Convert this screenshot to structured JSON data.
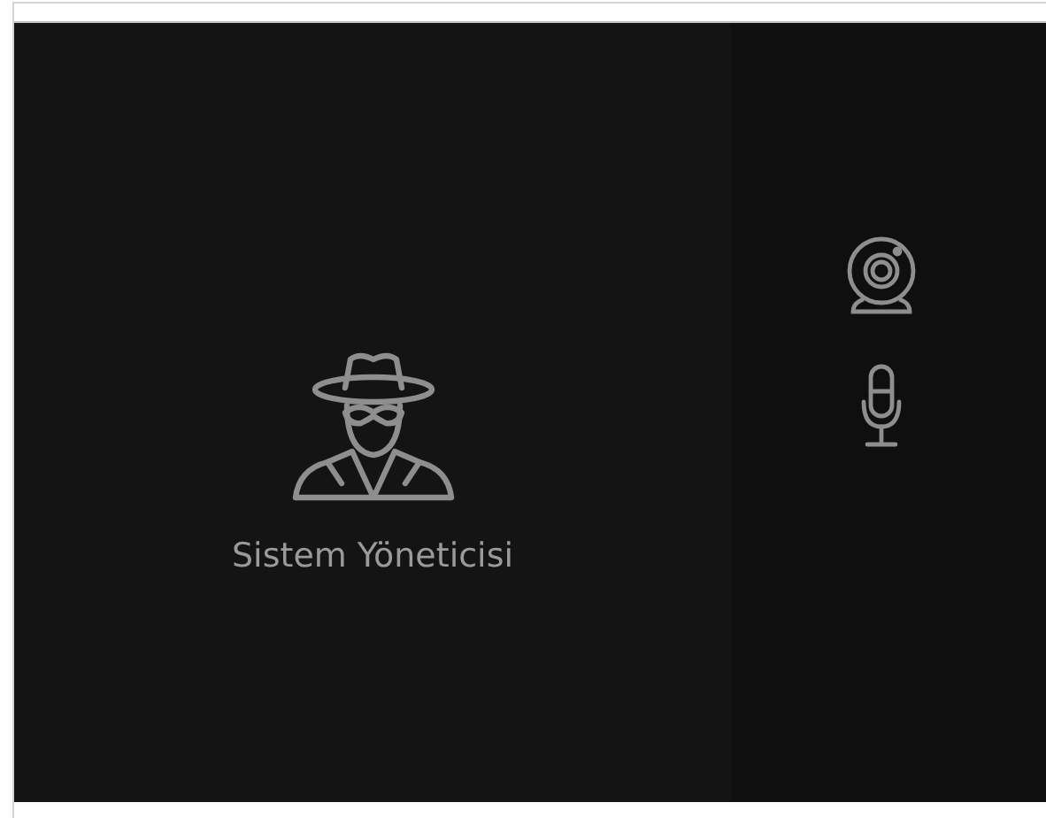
{
  "participant": {
    "name": "Sistem Yöneticisi"
  }
}
